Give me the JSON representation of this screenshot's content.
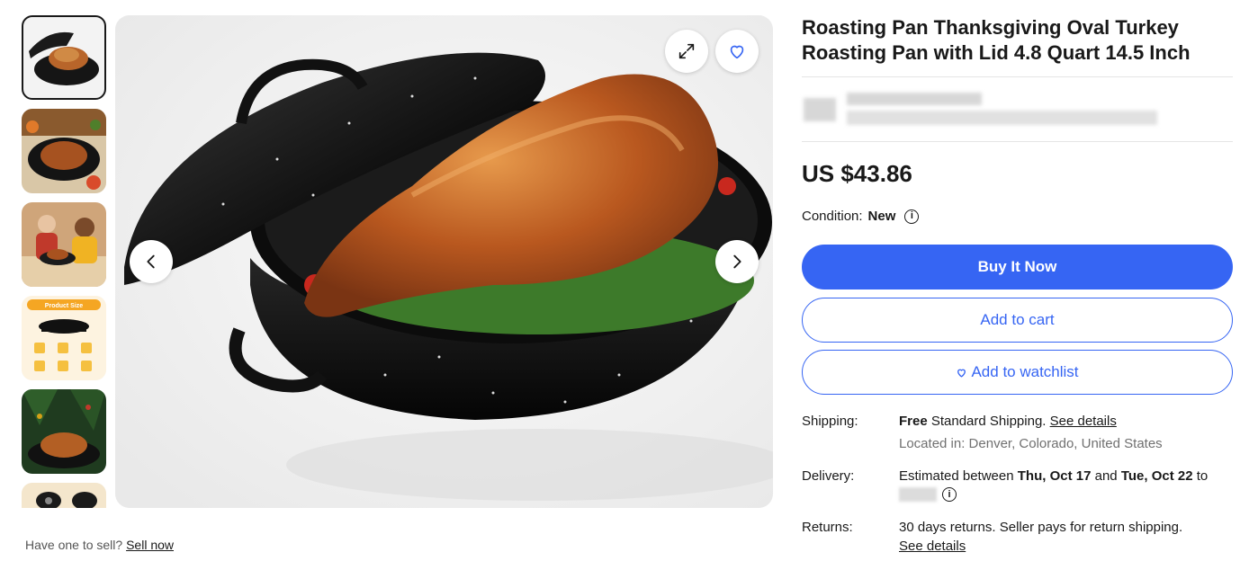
{
  "gallery": {
    "thumbnails": [
      {
        "label": "thumbnail-1",
        "selected": true
      },
      {
        "label": "thumbnail-2",
        "selected": false
      },
      {
        "label": "thumbnail-3",
        "selected": false
      },
      {
        "label": "thumbnail-4",
        "selected": false,
        "text": "Product Size"
      },
      {
        "label": "thumbnail-5",
        "selected": false
      },
      {
        "label": "thumbnail-6",
        "selected": false
      }
    ],
    "icons": {
      "expand": "expand-icon",
      "heart": "heart-icon",
      "prev": "chevron-left-icon",
      "next": "chevron-right-icon"
    }
  },
  "sell": {
    "prompt": "Have one to sell?",
    "link": "Sell now"
  },
  "product": {
    "title": "Roasting Pan Thanksgiving Oval Turkey Roasting Pan with Lid 4.8 Quart 14.5 Inch",
    "price": "US $43.86",
    "condition_label": "Condition:",
    "condition_value": "New"
  },
  "actions": {
    "buy_now": "Buy It Now",
    "add_to_cart": "Add to cart",
    "add_to_watchlist": "Add to watchlist"
  },
  "shipping": {
    "label": "Shipping:",
    "free": "Free",
    "standard": " Standard Shipping. ",
    "details_link": "See details",
    "location": "Located in: Denver, Colorado, United States"
  },
  "delivery": {
    "label": "Delivery:",
    "prefix": "Estimated between ",
    "start": "Thu, Oct 17",
    "and": " and ",
    "end": "Tue, Oct 22",
    "to": " to"
  },
  "returns": {
    "label": "Returns:",
    "text": "30 days returns. Seller pays for return shipping.",
    "details_link": "See details"
  },
  "colors": {
    "accent": "#3665f3",
    "text": "#191919",
    "muted": "#707070"
  }
}
